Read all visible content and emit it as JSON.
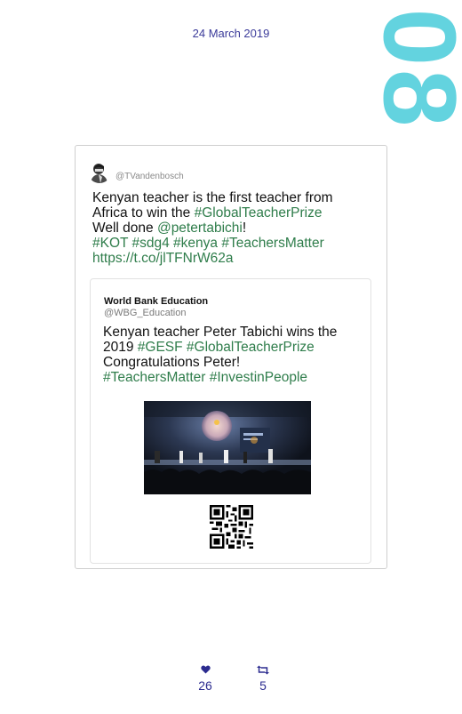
{
  "date": "24 March 2019",
  "big_number": "08",
  "tweet": {
    "handle": "@TVandenbosch",
    "lines": [
      [
        "Kenyan teacher is the first teacher from"
      ],
      [
        "Africa to win the ",
        "#GlobalTeacherPrize"
      ],
      [
        "Well done ",
        "@petertabichi",
        "!"
      ],
      [
        "#KOT #sdg4 #kenya #TeachersMatter"
      ],
      [
        "https://t.co/jlTFNrW62a"
      ]
    ]
  },
  "quote": {
    "name": "World Bank Education",
    "handle": "@WBG_Education",
    "lines": [
      [
        "Kenyan teacher Peter Tabichi wins the"
      ],
      [
        "2019 ",
        "#GESF #GlobalTeacherPrize"
      ],
      [
        "Congratulations Peter!"
      ],
      [
        "#TeachersMatter #InvestinPeople"
      ]
    ]
  },
  "stats": {
    "likes": "26",
    "retweets": "5"
  },
  "colors": {
    "accent_link": "#2f7d4b",
    "date_text": "#3b3b9a",
    "big_number": "#63d3df",
    "stats": "#2b2b8f"
  },
  "icons": {
    "likes": "heart-icon",
    "retweets": "retweet-icon"
  }
}
